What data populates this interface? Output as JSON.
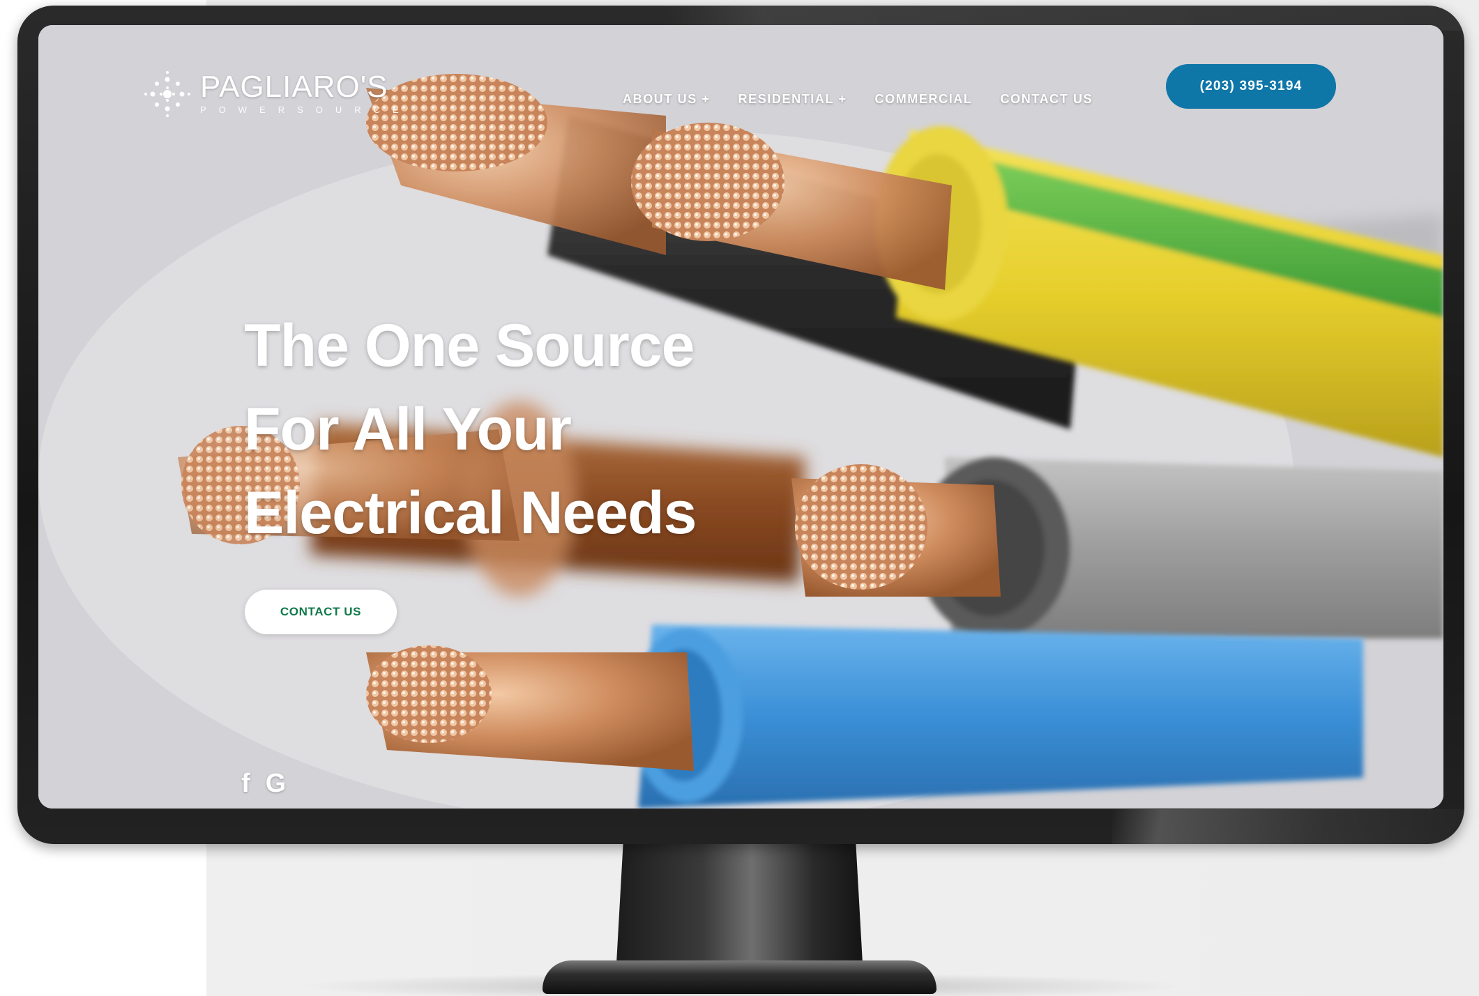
{
  "header": {
    "brand_name": "PAGLIARO'S",
    "brand_tagline": "POWERSOURCE",
    "nav": [
      {
        "label": "ABOUT US +"
      },
      {
        "label": "RESIDENTIAL +"
      },
      {
        "label": "COMMERCIAL"
      },
      {
        "label": "CONTACT US"
      }
    ],
    "phone_label": "(203) 395-3194"
  },
  "hero": {
    "headline_lines": [
      "The One Source",
      "For All Your",
      "Electrical Needs"
    ],
    "cta_label": "CONTACT US"
  },
  "social": {
    "facebook_glyph": "f",
    "google_glyph": "G"
  },
  "colors": {
    "phone_button": "#0f76a8",
    "cta_text": "#0f7a4a",
    "copper": "#c98a5e",
    "wire_yellow": "#e8d43a",
    "wire_green": "#5bb845",
    "wire_blue": "#3a8fd6",
    "wire_brown": "#8a4a22",
    "wire_gray": "#9a9a9a"
  }
}
